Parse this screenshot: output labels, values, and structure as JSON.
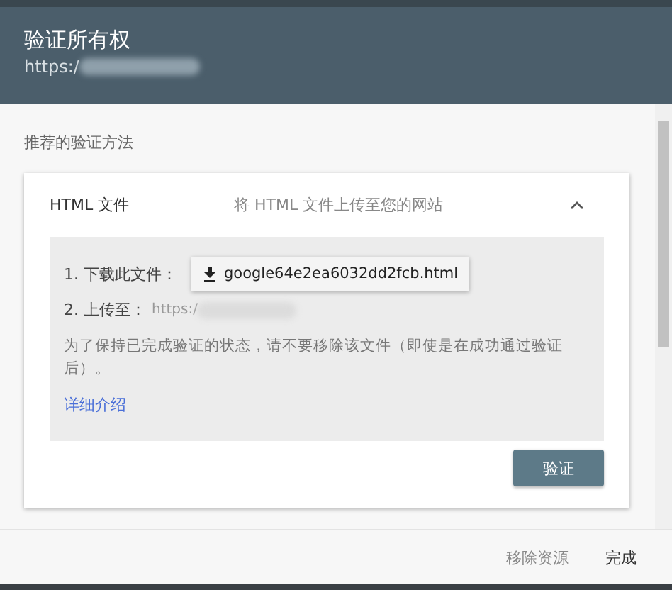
{
  "header": {
    "title": "验证所有权",
    "url": "https:/"
  },
  "section_label": "推荐的验证方法",
  "method": {
    "name": "HTML 文件",
    "description": "将 HTML 文件上传至您的网站",
    "expanded": true,
    "step1_label": "1. 下载此文件：",
    "download_file": "google64e2ea6032dd2fcb.html",
    "step2_label": "2. 上传至：",
    "step2_url": "https:/",
    "note": "为了保持已完成验证的状态，请不要移除该文件（即使是在成功通过验证后）。",
    "details_link": "详细介绍",
    "verify_button": "验证"
  },
  "footer": {
    "buttons": [
      "移除资源",
      "完成"
    ]
  }
}
